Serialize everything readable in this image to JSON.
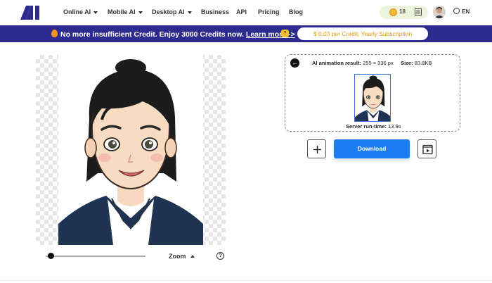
{
  "nav": {
    "logo": "AI",
    "items": [
      {
        "label": "Online AI",
        "dropdown": true
      },
      {
        "label": "Mobile AI",
        "dropdown": true
      },
      {
        "label": "Desktop AI",
        "dropdown": true
      },
      {
        "label": "Business",
        "dropdown": false
      },
      {
        "label": "API",
        "dropdown": false
      },
      {
        "label": "Pricing",
        "dropdown": false
      },
      {
        "label": "Blog",
        "dropdown": false
      }
    ],
    "credits": "18",
    "language": "EN"
  },
  "banner": {
    "text": "No more insufficient Credit. Enjoy 3000 Credits now.",
    "link": "Learn more ->",
    "subscription": "$ 0.03 per Credit, Yearly Subscription"
  },
  "editor": {
    "zoom_label": "Zoom",
    "help": "?"
  },
  "result": {
    "title_label": "AI animation result:",
    "dimensions": "255 × 336 px",
    "size_label": "Size:",
    "size_value": "83.8KB",
    "runtime_label": "Server run-time:",
    "runtime_value": "13.9s"
  },
  "actions": {
    "add": "+",
    "download": "Download"
  },
  "colors": {
    "brand": "#2e2b8f",
    "download": "#1e7cf2",
    "subscription_text": "#e39b00"
  }
}
